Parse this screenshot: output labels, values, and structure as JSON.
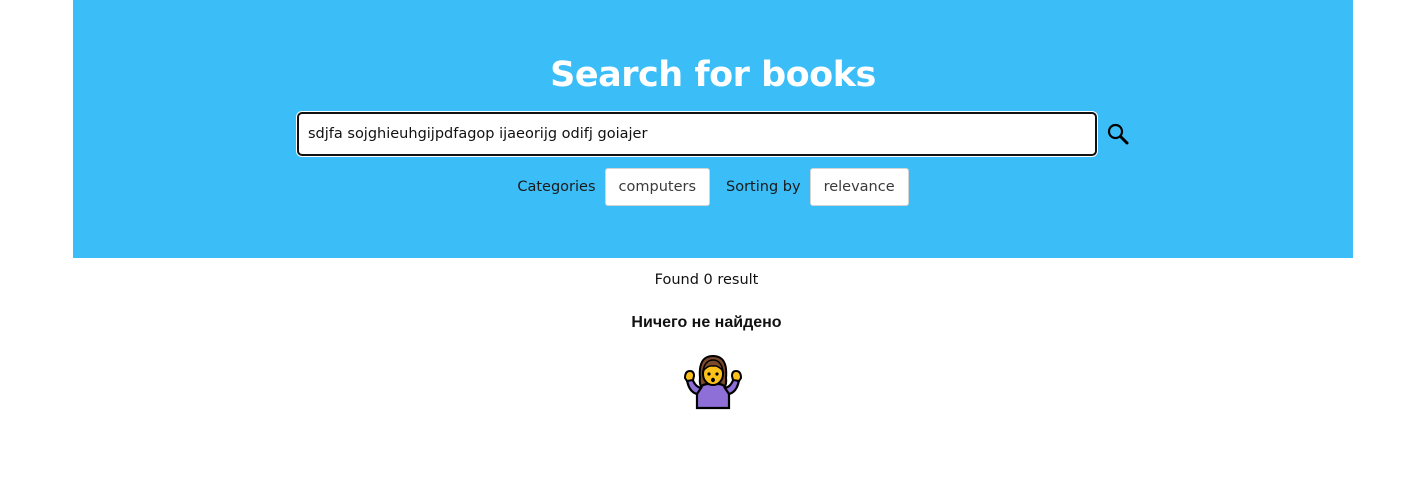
{
  "header": {
    "title": "Search for books"
  },
  "search": {
    "value": "sdjfa sojghieuhgijpdfagop ijaeorijg odifj goiajer",
    "button_icon": "search-icon"
  },
  "filters": {
    "categories_label": "Categories",
    "categories_value": "computers",
    "sorting_label": "Sorting by",
    "sorting_value": "relevance"
  },
  "results": {
    "found_text": "Found 0 result",
    "empty_message": "Ничего не найдено",
    "empty_icon": "person-shrugging-icon"
  },
  "colors": {
    "banner": "#3bbdf8",
    "title": "#ffffff",
    "emoji_shirt": "#8e6fd8",
    "emoji_skin": "#fcc21b"
  }
}
